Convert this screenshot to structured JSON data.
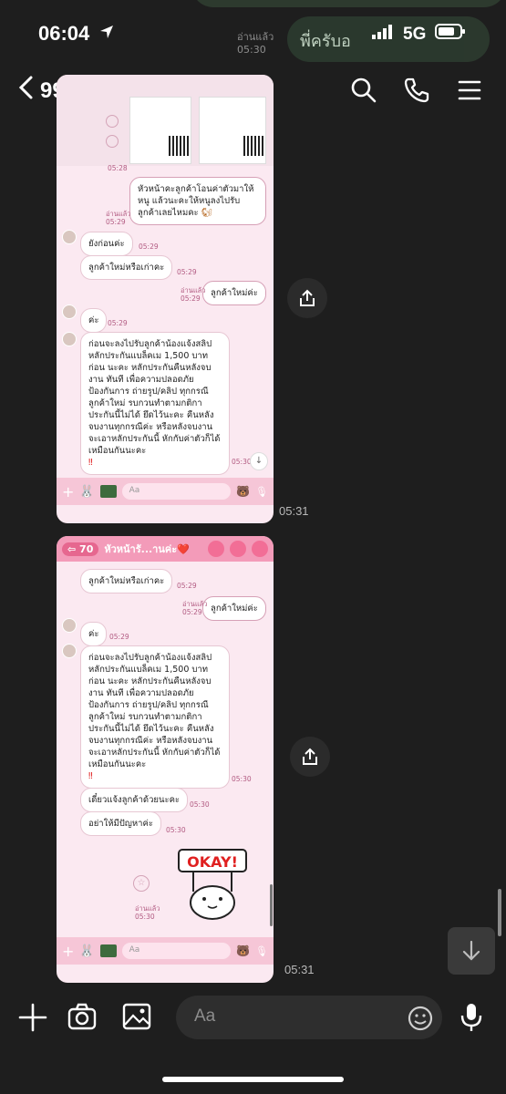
{
  "status": {
    "time": "06:04",
    "network": "5G"
  },
  "header": {
    "back_count": "99+",
    "emoji": "😍"
  },
  "ghost_text": "พี่ครับอ",
  "top_ts": {
    "read": "อ่านแล้ว",
    "time": "05:30"
  },
  "screenshot1": {
    "time": "05:31",
    "messages": [
      {
        "side": "right",
        "text": "หัวหน้าคะลูกค้าโอนค่าตัวมาให้หนู แล้วนะคะให้หนูลงไปรับลูกค้าเลยไหมคะ",
        "read": "อ่านแล้ว",
        "time": "05:29"
      },
      {
        "side": "left",
        "text": "ยังก่อนค่ะ",
        "time": "05:29"
      },
      {
        "side": "left",
        "text": "ลูกค้าใหม่หรือเก่าคะ",
        "time": "05:29"
      },
      {
        "side": "right",
        "text": "ลูกค้าใหม่ค่ะ",
        "read": "อ่านแล้ว",
        "time": "05:29"
      },
      {
        "side": "left",
        "text": "ค่ะ",
        "time": "05:29"
      },
      {
        "side": "left",
        "text": "ก่อนจะลงไปรับลูกค้าน้องแจ้งสลิป หลักประกันแบล็คเม 1,500 บาทก่อน นะคะ หลักประกันคืนหลังจบงาน ทันที เพื่อความปลอดภัย ป้องกันการ ถ่ายรูป/คลิป ทุกกรณี ลูกค้าใหม่ รบกวนทำตามกติกา ประกันนี้ไม่ได้ ยึดไว้นะคะ คืนหลังจบงานทุกกรณีค่ะ หรือหลังจบงานจะเอาหลักประกันนี้ หักกับค่าตัวก็ได้เหมือนกันนะคะ",
        "time": "05:30"
      }
    ],
    "top_times": [
      "05:28"
    ],
    "input_placeholder": "Aa"
  },
  "screenshot2": {
    "time": "05:31",
    "back_count": "70",
    "chat_title": "หัวหน้ารั...านค่ะ❤️",
    "messages": [
      {
        "side": "left",
        "text": "ลูกค้าใหม่หรือเก่าคะ",
        "time": "05:29"
      },
      {
        "side": "right",
        "text": "ลูกค้าใหม่ค่ะ",
        "read": "อ่านแล้ว",
        "time": "05:29"
      },
      {
        "side": "left",
        "text": "ค่ะ",
        "time": "05:29"
      },
      {
        "side": "left",
        "text": "ก่อนจะลงไปรับลูกค้าน้องแจ้งสลิป หลักประกันแบล็คเม 1,500 บาทก่อน นะคะ หลักประกันคืนหลังจบงาน ทันที เพื่อความปลอดภัย ป้องกันการ ถ่ายรูป/คลิป ทุกกรณี ลูกค้าใหม่ รบกวนทำตามกติกา ประกันนี้ไม่ได้ ยึดไว้นะคะ คืนหลังจบงานทุกกรณีค่ะ หรือหลังจบงานจะเอาหลักประกันนี้ หักกับค่าตัวก็ได้เหมือนกันนะคะ",
        "time": "05:30"
      },
      {
        "side": "left",
        "text": "เดี๋ยวแจ้งลูกค้าด้วยนะคะ",
        "time": "05:30"
      },
      {
        "side": "left",
        "text": "อย่าให้มีปัญหาค่ะ",
        "time": "05:30"
      }
    ],
    "sticker_text": "OKAY!",
    "sticker_read": "อ่านแล้ว",
    "sticker_time": "05:30",
    "input_placeholder": "Aa"
  },
  "composer": {
    "placeholder": "Aa"
  },
  "colors": {
    "bg": "#1e1e1e",
    "line_pink": "#f39bb9",
    "chat_bg": "#fbe9f1"
  }
}
